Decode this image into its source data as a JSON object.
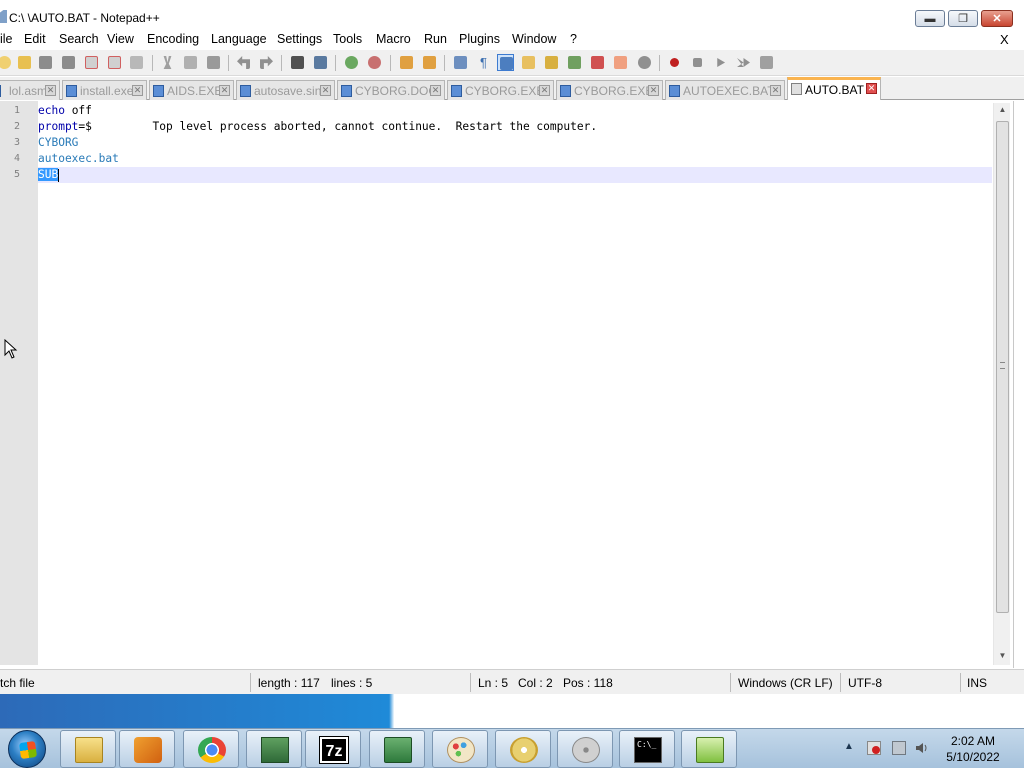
{
  "window": {
    "title": "C:\\ \\AUTO.BAT - Notepad++",
    "min_glyph": "▬",
    "max_glyph": "❐",
    "close_glyph": "✕"
  },
  "menu": {
    "items": [
      "ile",
      "Edit",
      "Search",
      "View",
      "Encoding",
      "Language",
      "Settings",
      "Tools",
      "Macro",
      "Run",
      "Plugins",
      "Window",
      "?"
    ],
    "close_x": "X"
  },
  "toolbar": {
    "icons": [
      "new-file-icon",
      "open-file-icon",
      "save-icon",
      "save-all-icon",
      "close-icon",
      "close-all-icon",
      "print-icon",
      "cut-icon",
      "copy-icon",
      "paste-icon",
      "undo-icon",
      "redo-icon",
      "find-icon",
      "replace-icon",
      "zoom-in-icon",
      "zoom-out-icon",
      "sync-vertical-icon",
      "sync-horizontal-icon",
      "word-wrap-icon",
      "show-all-chars-icon",
      "indent-guide-icon",
      "user-language-icon",
      "doc-map-icon",
      "function-list-icon",
      "folder-workspace-icon",
      "monitoring-icon",
      "record-macro-icon",
      "stop-macro-icon",
      "play-macro-icon",
      "run-macro-multiple-icon",
      "save-macro-icon"
    ],
    "active_icon": "indent-guide-icon"
  },
  "tabs": [
    {
      "label": "lol.asm",
      "active": false
    },
    {
      "label": "install.exe",
      "active": false
    },
    {
      "label": "AIDS.EXE",
      "active": false
    },
    {
      "label": "autosave.sin",
      "active": false
    },
    {
      "label": "CYBORG.DOC",
      "active": false
    },
    {
      "label": "CYBORG.EXE",
      "active": false
    },
    {
      "label": "CYBORG.EXE",
      "active": false
    },
    {
      "label": "AUTOEXEC.BAT",
      "active": false
    },
    {
      "label": "AUTO.BAT",
      "active": true
    }
  ],
  "editor": {
    "line_numbers": [
      "1",
      "2",
      "3",
      "4",
      "5"
    ],
    "line1_kw": "echo",
    "line1_rest": " off",
    "line2_kw": "prompt",
    "line2_rest": "=$         Top level process aborted, cannot continue.  Restart the computer.",
    "line3": "CYBORG",
    "line4": "autoexec.bat",
    "line5_selected": "SUB"
  },
  "status": {
    "file_type": "tch file",
    "length": "length : 117",
    "lines": "lines : 5",
    "ln": "Ln : 5",
    "col": "Col : 2",
    "pos": "Pos : 118",
    "eol": "Windows (CR LF)",
    "encoding": "UTF-8",
    "mode": "INS"
  },
  "taskbar": {
    "apps": [
      "file-explorer-icon",
      "media-player-icon",
      "chrome-icon",
      "network-card-icon",
      "7zip-icon",
      "computer-chip-icon",
      "paint-icon",
      "dvd-icon",
      "disk-tool-icon",
      "command-prompt-icon",
      "notepad-plus-plus-icon"
    ],
    "app_7zip_text": "7z",
    "cmd_text": "C:\\_",
    "tray_arrow": "▲",
    "clock_time": "2:02 AM",
    "clock_date": "5/10/2022"
  },
  "colors": {
    "selection": "#3399ff",
    "caret_line": "#e8e8ff",
    "active_tab_accent": "#fab450",
    "keyword": "#0000aa",
    "plain_text": "#2a7bb8"
  }
}
